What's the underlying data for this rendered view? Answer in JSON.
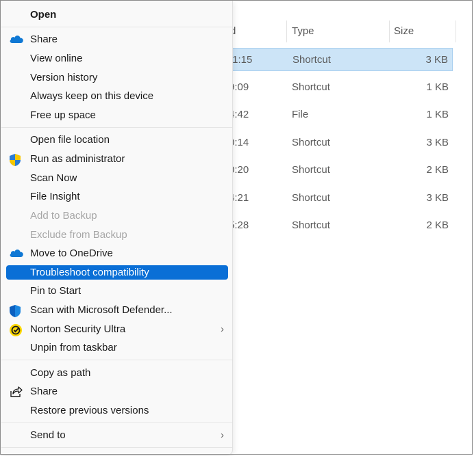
{
  "explorer": {
    "columns": {
      "date_partial": "d",
      "type": "Type",
      "size": "Size"
    },
    "rows": [
      {
        "time": ":1:15",
        "type": "Shortcut",
        "size": "3 KB",
        "selected": true
      },
      {
        "time": "9:09",
        "type": "Shortcut",
        "size": "1 KB"
      },
      {
        "time": "4:42",
        "type": "File",
        "size": "1 KB"
      },
      {
        "time": "0:14",
        "type": "Shortcut",
        "size": "3 KB"
      },
      {
        "time": "0:20",
        "type": "Shortcut",
        "size": "2 KB"
      },
      {
        "time": "4:21",
        "type": "Shortcut",
        "size": "3 KB"
      },
      {
        "time": "5:28",
        "type": "Shortcut",
        "size": "2 KB"
      }
    ]
  },
  "menu": {
    "open": "Open",
    "share_onedrive": "Share",
    "view_online": "View online",
    "version_history": "Version history",
    "always_keep": "Always keep on this device",
    "free_up_space": "Free up space",
    "open_file_location": "Open file location",
    "run_as_admin": "Run as administrator",
    "scan_now": "Scan Now",
    "file_insight": "File Insight",
    "add_to_backup": "Add to Backup",
    "exclude_from_backup": "Exclude from Backup",
    "move_to_onedrive": "Move to OneDrive",
    "troubleshoot": "Troubleshoot compatibility",
    "pin_to_start": "Pin to Start",
    "scan_defender": "Scan with Microsoft Defender...",
    "norton": "Norton Security Ultra",
    "unpin_taskbar": "Unpin from taskbar",
    "copy_as_path": "Copy as path",
    "share": "Share",
    "restore_previous": "Restore previous versions",
    "send_to": "Send to"
  },
  "icons": {
    "onedrive": "onedrive-cloud-icon",
    "uac_shield": "uac-shield-icon",
    "defender": "defender-shield-icon",
    "norton": "norton-check-icon",
    "share": "share-arrow-icon",
    "chevron": "chevron-right-icon"
  },
  "colors": {
    "selection": "#cce4f7",
    "highlight": "#0a6fd6",
    "onedrive": "#0f78d4",
    "norton": "#ffd800"
  }
}
